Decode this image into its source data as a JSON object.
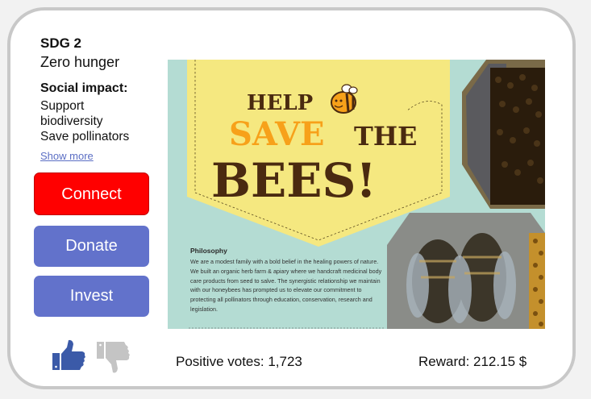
{
  "sdg": {
    "number": "SDG 2",
    "name": "Zero hunger"
  },
  "impact": {
    "title": "Social impact:",
    "lines": [
      "Support",
      "biodiversity",
      "Save pollinators"
    ],
    "show_more": "Show more"
  },
  "buttons": {
    "connect": "Connect",
    "donate": "Donate",
    "invest": "Invest"
  },
  "footer": {
    "votes": "Positive votes: 1,723",
    "reward": "Reward: 212.15 $"
  },
  "poster": {
    "line1": "HELP",
    "line2a": "SAVE",
    "line2b": "THE",
    "line3": "BEES!",
    "philosophy_title": "Philosophy",
    "philosophy_text": "We are a modest family with a bold belief in the healing powers of nature.  We built an organic herb farm & apiary where we handcraft medicinal body care products from seed to salve. The synergistic relationship we maintain with our honeybees has prompted us to elevate our commitment to protecting all pollinators through education, conservation, research and legislation."
  },
  "colors": {
    "connect": "#ff0000",
    "donate": "#6272cb",
    "invest": "#6272cb",
    "thumb_up": "#3b5aa8",
    "thumb_down": "#c4c4c4",
    "poster_bg": "#b4dcd3",
    "poster_yellow": "#f5e880",
    "poster_brown": "#4a2a10",
    "poster_orange": "#f7a11a"
  },
  "icons": {
    "like": "thumbs-up-icon",
    "dislike": "thumbs-down-icon",
    "bee": "bee-icon"
  }
}
